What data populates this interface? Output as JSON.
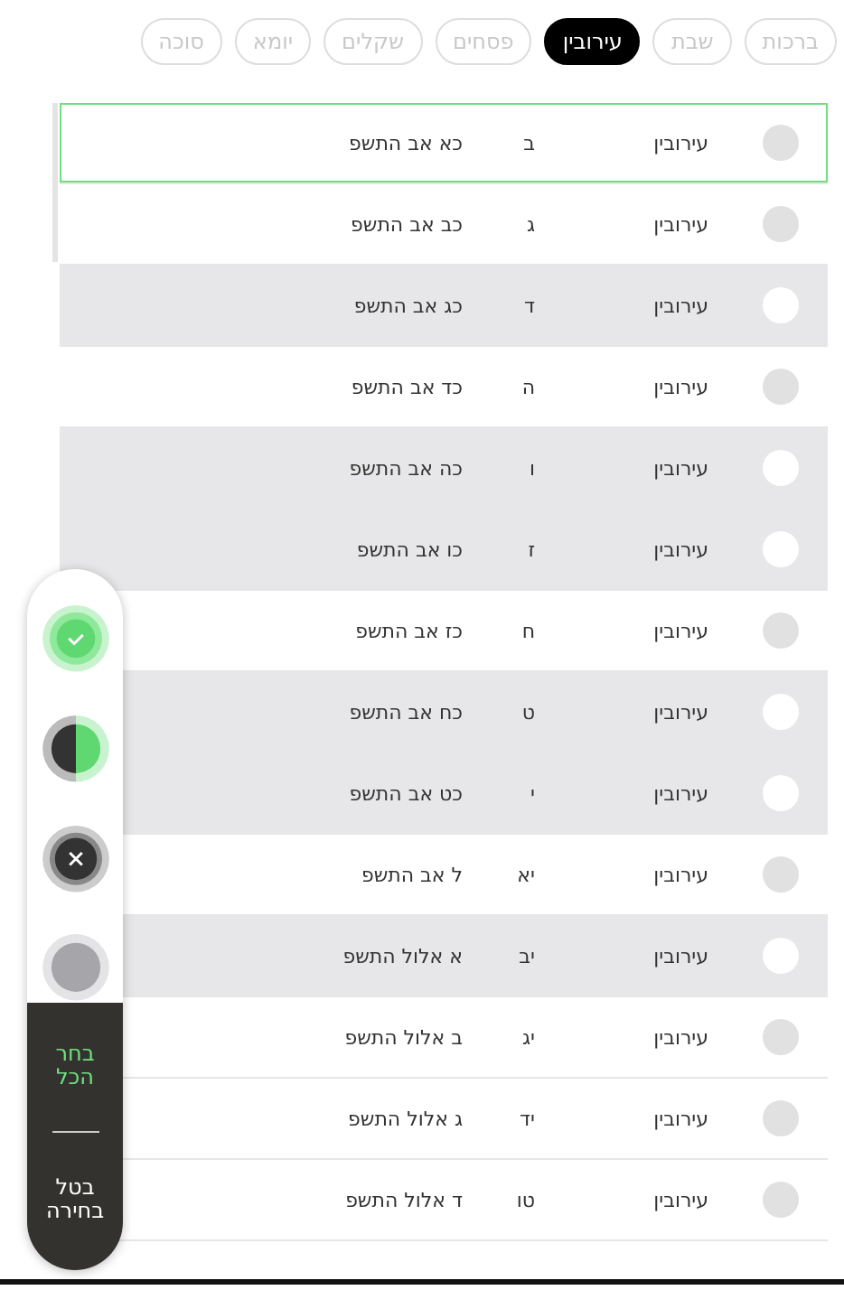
{
  "tabs": [
    {
      "label": "ברכות",
      "selected": false
    },
    {
      "label": "שבת",
      "selected": false
    },
    {
      "label": "עירובין",
      "selected": true
    },
    {
      "label": "פסחים",
      "selected": false
    },
    {
      "label": "שקלים",
      "selected": false
    },
    {
      "label": "יומא",
      "selected": false
    },
    {
      "label": "סוכה",
      "selected": false
    }
  ],
  "rows": [
    {
      "tractate": "עירובין",
      "daf": "ב",
      "date": "כא אב התשפ",
      "marked": false,
      "highlighted": true
    },
    {
      "tractate": "עירובין",
      "daf": "ג",
      "date": "כב אב התשפ",
      "marked": false,
      "highlighted": false
    },
    {
      "tractate": "עירובין",
      "daf": "ד",
      "date": "כג אב התשפ",
      "marked": true,
      "highlighted": false
    },
    {
      "tractate": "עירובין",
      "daf": "ה",
      "date": "כד אב התשפ",
      "marked": false,
      "highlighted": false
    },
    {
      "tractate": "עירובין",
      "daf": "ו",
      "date": "כה אב התשפ",
      "marked": true,
      "highlighted": false
    },
    {
      "tractate": "עירובין",
      "daf": "ז",
      "date": "כו אב התשפ",
      "marked": true,
      "highlighted": false
    },
    {
      "tractate": "עירובין",
      "daf": "ח",
      "date": "כז אב התשפ",
      "marked": false,
      "highlighted": false
    },
    {
      "tractate": "עירובין",
      "daf": "ט",
      "date": "כח אב התשפ",
      "marked": true,
      "highlighted": false
    },
    {
      "tractate": "עירובין",
      "daf": "י",
      "date": "כט אב התשפ",
      "marked": true,
      "highlighted": false
    },
    {
      "tractate": "עירובין",
      "daf": "יא",
      "date": "ל אב התשפ",
      "marked": false,
      "highlighted": false
    },
    {
      "tractate": "עירובין",
      "daf": "יב",
      "date": "א אלול התשפ",
      "marked": true,
      "highlighted": false
    },
    {
      "tractate": "עירובין",
      "daf": "יג",
      "date": "ב אלול התשפ",
      "marked": false,
      "highlighted": false
    },
    {
      "tractate": "עירובין",
      "daf": "יד",
      "date": "ג אלול התשפ",
      "marked": false,
      "highlighted": false
    },
    {
      "tractate": "עירובין",
      "daf": "טו",
      "date": "ד אלול התשפ",
      "marked": false,
      "highlighted": false
    }
  ],
  "panel": {
    "tools": [
      {
        "kind": "done"
      },
      {
        "kind": "half"
      },
      {
        "kind": "cancel"
      },
      {
        "kind": "clear"
      }
    ],
    "select_all": "בחר הכל",
    "cancel_selection": "בטל בחירה"
  }
}
